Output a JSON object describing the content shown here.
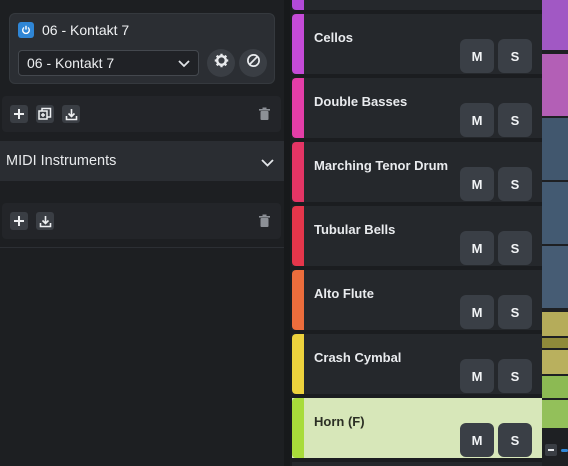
{
  "instrument": {
    "title": "06 - Kontakt 7",
    "selected": "06 - Kontakt 7"
  },
  "section": {
    "title": "MIDI Instruments"
  },
  "colors": {
    "accent": "#2f86d6",
    "selected_track_bg": "#d7e7b9"
  },
  "tracks": [
    {
      "name": "Cellos",
      "color": "#c44bd7",
      "mute": "M",
      "solo": "S"
    },
    {
      "name": "Double Basses",
      "color": "#e43ea8",
      "mute": "M",
      "solo": "S"
    },
    {
      "name": "Marching Tenor Drum",
      "color": "#e43565",
      "mute": "M",
      "solo": "S"
    },
    {
      "name": "Tubular Bells",
      "color": "#e5364b",
      "mute": "M",
      "solo": "S"
    },
    {
      "name": "Alto Flute",
      "color": "#ec6d3c",
      "mute": "M",
      "solo": "S"
    },
    {
      "name": "Crash Cymbal",
      "color": "#edd23d",
      "mute": "M",
      "solo": "S"
    },
    {
      "name": "Horn (F)",
      "color": "#a8dc3a",
      "mute": "M",
      "solo": "S"
    }
  ]
}
